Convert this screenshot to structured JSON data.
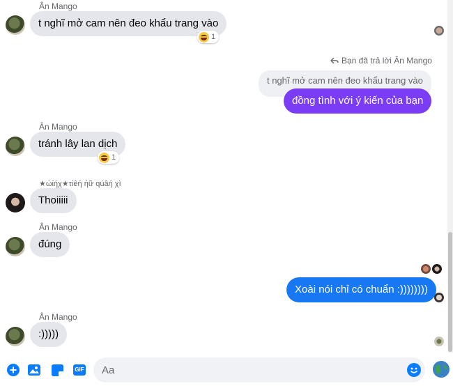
{
  "colors": {
    "outgoing_purple": "#7b3cf5",
    "outgoing_blue": "#1877f2",
    "incoming_bg": "#e4e6eb",
    "accent_icon": "#0a7cff"
  },
  "messages": [
    {
      "sender": "Ân Mango",
      "text": "t nghĩ mở cam nên đeo khẩu trang vào",
      "reaction_count": "1"
    },
    {
      "reply_note": "Bạn đã trả lời Ân Mango",
      "quoted_text": "t nghĩ mở cam nên đeo khẩu trang vào",
      "text": "đồng tình với ý kiến của bạn"
    },
    {
      "sender": "Ân Mango",
      "text": "tránh lây lan dịch",
      "reaction_count": "1"
    },
    {
      "sender": "★ώίήχ★τίêή ήữ qúâή χì",
      "text": "Thoiiiii"
    },
    {
      "sender": "Ân Mango",
      "text": "đúng"
    },
    {
      "text": "Xoài nói chỉ có chuẩn :))))))))"
    },
    {
      "sender": "Ân Mango",
      "text": ":)))))"
    }
  ],
  "composer": {
    "placeholder": "Aa",
    "icons": [
      "plus-circle-icon",
      "image-icon",
      "sticker-icon",
      "gif-icon",
      "emoji-icon",
      "globe-emoji-icon"
    ],
    "gif_label": "GIF"
  }
}
